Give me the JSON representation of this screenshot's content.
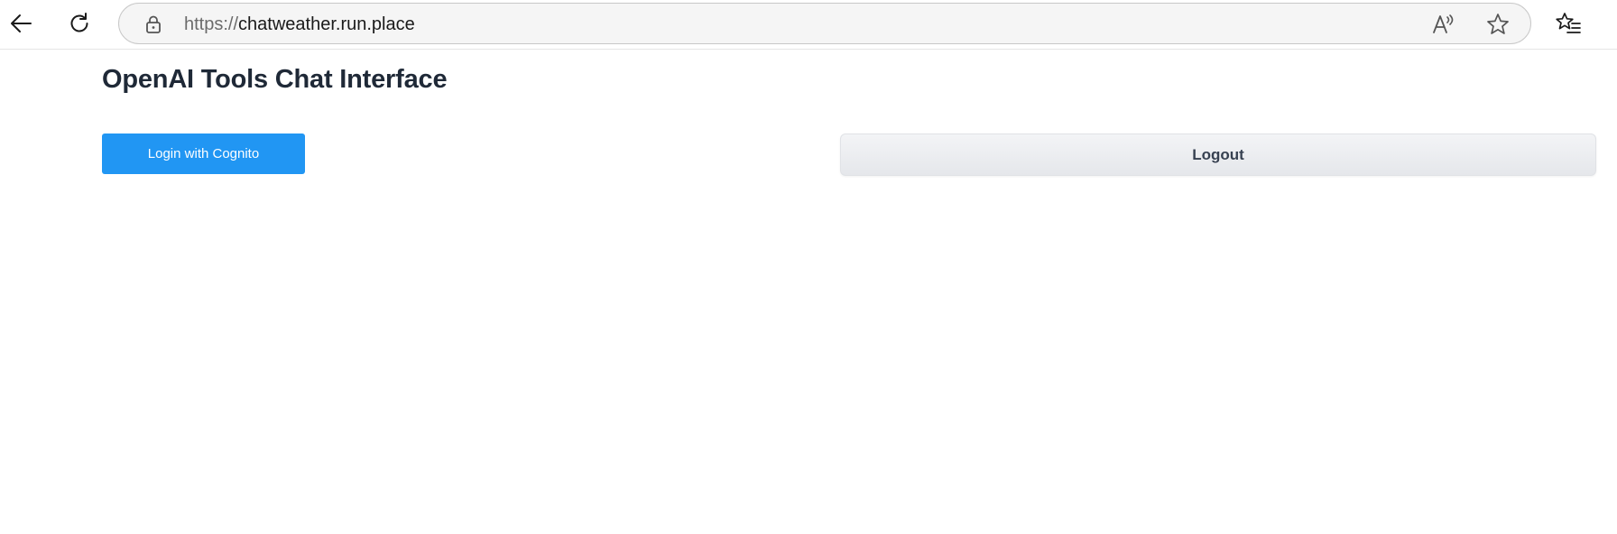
{
  "browser": {
    "url_scheme": "https://",
    "url_host": "chatweather.run.place",
    "icons": {
      "back": "back-arrow-icon",
      "reload": "reload-icon",
      "lock": "lock-icon",
      "read_aloud": "read-aloud-icon",
      "favorite": "star-icon",
      "favorites": "favorites-list-icon"
    }
  },
  "page": {
    "title": "OpenAI Tools Chat Interface",
    "login_label": "Login with Cognito",
    "logout_label": "Logout"
  },
  "colors": {
    "primary_button": "#2196f3",
    "secondary_button": "#e5e7eb",
    "title_text": "#1f2937"
  }
}
